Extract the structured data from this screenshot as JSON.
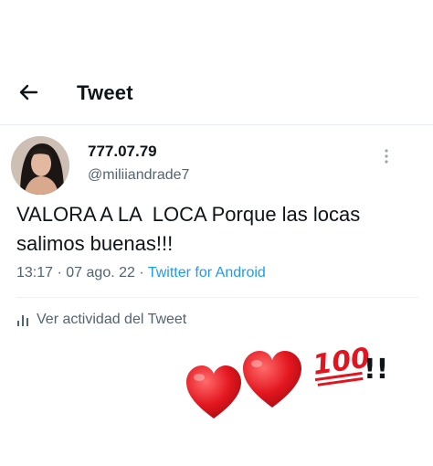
{
  "header": {
    "title": "Tweet"
  },
  "tweet": {
    "display_name": "777.07.79",
    "handle": "@miliiandrade7",
    "text": "VALORA A LA  LOCA Porque las locas\nsalimos buenas!!!",
    "time": "13:17",
    "date": "07 ago. 22",
    "source": "Twitter for Android",
    "separator": "·"
  },
  "activity": {
    "label": "Ver actividad del Tweet"
  },
  "overlay": {
    "text": "100",
    "exclaim": "!!"
  },
  "colors": {
    "accent": "#1d9bf0",
    "heart": "#e0151f",
    "hundred": "#e0151f",
    "muted": "#536471"
  },
  "icons": [
    "back-arrow-icon",
    "more-options-icon",
    "analytics-icon",
    "heart-icon",
    "hundred-points-icon"
  ]
}
